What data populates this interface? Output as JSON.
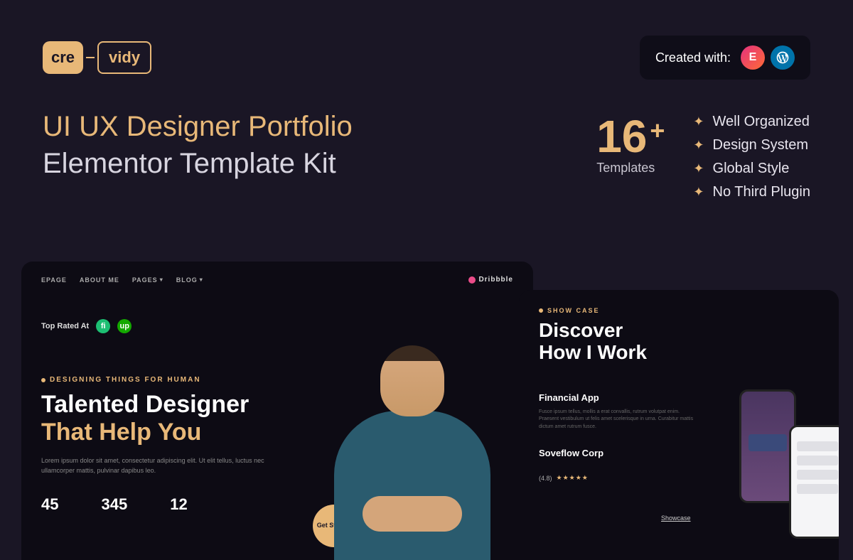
{
  "logo": {
    "part1": "cre",
    "part2": "vidy"
  },
  "created_with": {
    "label": "Created with:"
  },
  "title": {
    "line1": "UI UX Designer Portfolio",
    "line2": "Elementor Template Kit"
  },
  "count": {
    "number": "16",
    "plus": "+",
    "label": "Templates"
  },
  "features": [
    "Well Organized",
    "Design System",
    "Global Style",
    "No Third Plugin"
  ],
  "preview_left": {
    "nav": [
      "EPAGE",
      "ABOUT ME",
      "PAGES",
      "BLOG"
    ],
    "dribbble": "Dribbble",
    "toprated": "Top Rated At",
    "eyebrow": "DESIGNING THINGS FOR HUMAN",
    "hero1": "Talented Designer",
    "hero2": "That Help You",
    "desc": "Lorem ipsum dolor sit amet, consectetur adipiscing elit. Ut elit tellus, luctus nec ullamcorper mattis, pulvinar dapibus leo.",
    "stats": [
      "45",
      "345",
      "12"
    ],
    "cta": "Get Started"
  },
  "preview_right": {
    "eyebrow": "SHOW CASE",
    "h1": "Discover",
    "h2": "How I Work",
    "section1_title": "Financial App",
    "desc": "Fusce ipsum tellus, mollis a erat convallis, rutrum volutpat enim. Praesent vestibulum ut felis amet scelerisque in urna. Curabitur mattis dictum amet rutrum fusce.",
    "section2_title": "Soveflow Corp",
    "rating_num": "(4.8)",
    "showcase": "Showcase"
  }
}
